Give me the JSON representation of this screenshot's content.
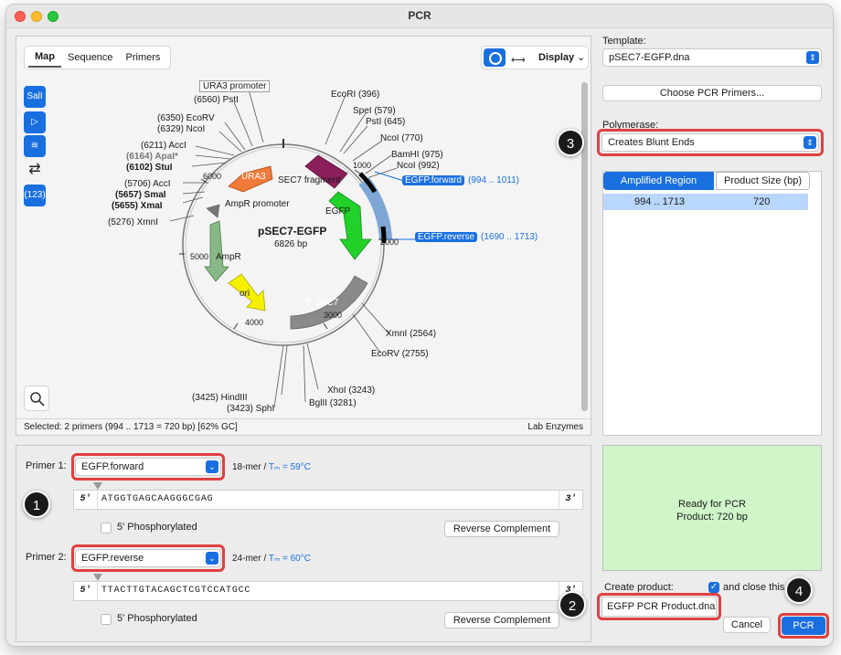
{
  "window": {
    "title": "PCR"
  },
  "map": {
    "tabs": [
      "Map",
      "Sequence",
      "Primers"
    ],
    "display_label": "Display",
    "plasmid_name": "pSEC7-EGFP",
    "plasmid_size": "6826 bp",
    "tools": [
      "SalI",
      "(123)"
    ],
    "enzymes": [
      {
        "label": "URA3 promoter"
      },
      {
        "label": "(6560)  PstI"
      },
      {
        "label": "(6350)  EcoRV"
      },
      {
        "label": "(6329)  NcoI"
      },
      {
        "label": "(6211)  AccI"
      },
      {
        "label": "(6164)  ApaI*"
      },
      {
        "label": "(6102)  StuI"
      },
      {
        "label": "(5706)  AccI"
      },
      {
        "label": "(5657)  SmaI"
      },
      {
        "label": "(5655)  XmaI"
      },
      {
        "label": "(5276)  XmnI"
      },
      {
        "label": "EcoRI  (396)"
      },
      {
        "label": "SpeI  (579)"
      },
      {
        "label": "PstI  (645)"
      },
      {
        "label": "NcoI  (770)"
      },
      {
        "label": "BamHI  (975)"
      },
      {
        "label": "NcoI  (992)"
      },
      {
        "label": "XmnI  (2564)"
      },
      {
        "label": "EcoRV  (2755)"
      },
      {
        "label": "XhoI  (3243)"
      },
      {
        "label": "BglII  (3281)"
      },
      {
        "label": "(3425)  HindIII"
      },
      {
        "label": "(3423)  SphI"
      }
    ],
    "features": {
      "ura3": "URA3",
      "sec7_fragment": "SEC7 fragment",
      "egfp": "EGFP",
      "ampr_promoter": "AmpR promoter",
      "ampr": "AmpR",
      "ori": "ori",
      "sec7_3prime": "3' SEC7"
    },
    "ticks": [
      "1000",
      "2000",
      "3000",
      "4000",
      "5000",
      "6000"
    ],
    "primer_forward_label": "EGFP.forward",
    "primer_forward_range": "(994 .. 1011)",
    "primer_reverse_label": "EGFP.reverse",
    "primer_reverse_range": "(1690 .. 1713)",
    "status_selected": "Selected:   2 primers   (994 .. 1713  =  720 bp)      [62% GC]",
    "status_enzymes": "Lab Enzymes"
  },
  "primer1": {
    "label": "Primer 1:",
    "name": "EGFP.forward",
    "mer": "18-mer  /",
    "tm": "Tₘ = 59°C",
    "five": "5'",
    "three": "3'",
    "sequence": "ATGGTGAGCAAGGGCGAG",
    "phos_label": "5' Phosphorylated",
    "rc_button": "Reverse Complement"
  },
  "primer2": {
    "label": "Primer 2:",
    "name": "EGFP.reverse",
    "mer": "24-mer  /",
    "tm": "Tₘ = 60°C",
    "five": "5'",
    "three": "3'",
    "sequence": "TTACTTGTACAGCTCGTCCATGCC",
    "phos_label": "5' Phosphorylated",
    "rc_button": "Reverse Complement"
  },
  "right": {
    "template_label": "Template:",
    "template_value": "pSEC7-EGFP.dna",
    "choose_button": "Choose PCR Primers...",
    "polymerase_label": "Polymerase:",
    "polymerase_value": "Creates Blunt Ends",
    "tab_amplified": "Amplified Region",
    "tab_product": "Product Size (bp)",
    "row_region": "994  ..  1713",
    "row_size": "720",
    "ready_line1": "Ready for PCR",
    "ready_line2": "Product:  720 bp",
    "create_label": "Create product:",
    "close_label": "and close this",
    "product_name": "EGFP PCR Product.dna",
    "cancel_button": "Cancel",
    "pcr_button": "PCR"
  },
  "badges": [
    "1",
    "2",
    "3",
    "4"
  ],
  "colors": {
    "accent": "#1a6fe0",
    "highlight": "#e04040",
    "ready_bg": "#cff5c9",
    "ura3": "#f07a3a",
    "sec7_fragment": "#8b1f5a",
    "egfp": "#22d12a",
    "ampr": "#88b888",
    "ori": "#f5f000",
    "sec7_3prime": "#8a8a8a",
    "primer_arc": "#7ea7d6"
  }
}
